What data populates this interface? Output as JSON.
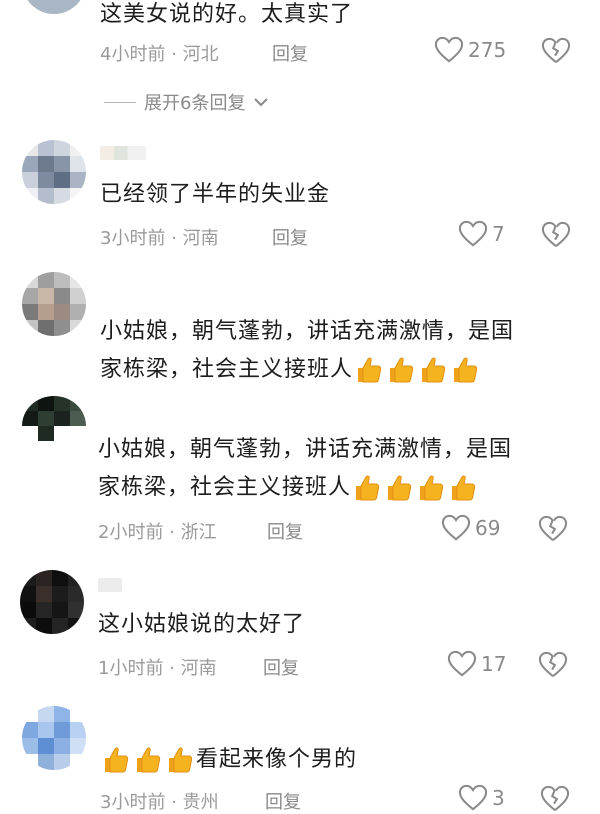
{
  "comments": [
    {
      "text": "这美女说的好。太真实了",
      "time": "4小时前",
      "region": "河北",
      "reply": "回复",
      "likes": "275"
    },
    {
      "text": "已经领了半年的失业金",
      "time": "3小时前",
      "region": "河南",
      "reply": "回复",
      "likes": "7"
    },
    {
      "text_line1": "小姑娘，朝气蓬勃，讲话充满激情，是国",
      "text_line2": "家栋梁，社会主义接班人"
    },
    {
      "text_line1": "小姑娘，朝气蓬勃，讲话充满激情，是国",
      "text_line2": "家栋梁，社会主义接班人",
      "time": "2小时前",
      "region": "浙江",
      "reply": "回复",
      "likes": "69"
    },
    {
      "text": "这小姑娘说的太好了",
      "time": "1小时前",
      "region": "河南",
      "reply": "回复",
      "likes": "17"
    },
    {
      "text": "看起来像个男的",
      "time": "3小时前",
      "region": "贵州",
      "reply": "回复",
      "likes": "3"
    }
  ],
  "expand_replies": "展开6条回复",
  "meta_separator": "·",
  "icons": [
    "heart-outline-icon",
    "broken-heart-icon",
    "chevron-down-icon",
    "thumbs-up-emoji"
  ],
  "colors": {
    "meta_text": "#9a9a9a",
    "main_text": "#1d1d1d",
    "emoji": "#f6b320"
  }
}
